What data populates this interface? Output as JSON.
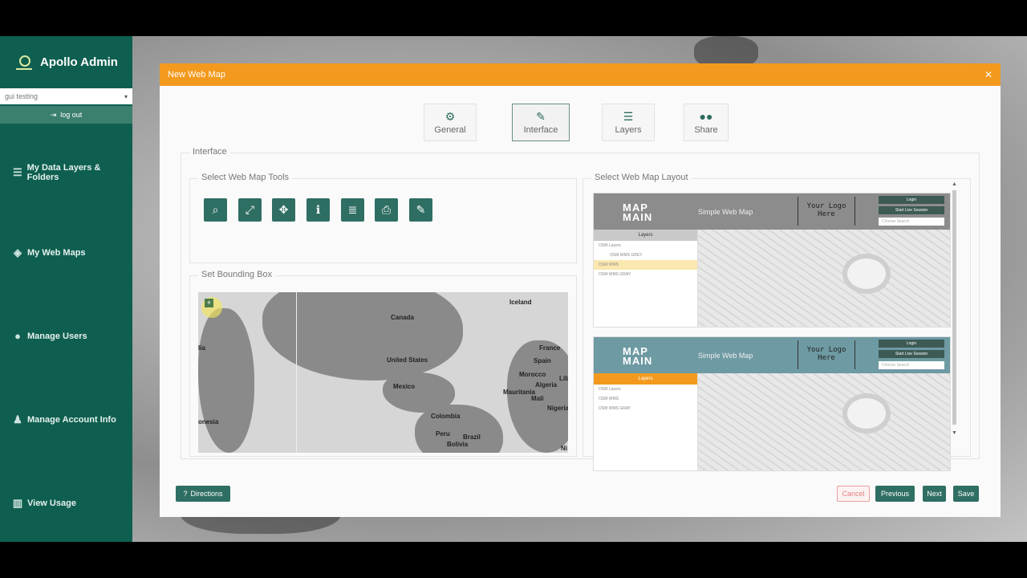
{
  "sidebar": {
    "brand": "Apollo Admin",
    "workspace": "gui testing",
    "logout_label": "log out",
    "items": [
      {
        "label": "My Data Layers & Folders",
        "icon": "list-icon"
      },
      {
        "label": "My Web Maps",
        "icon": "cube-icon"
      },
      {
        "label": "Manage Users",
        "icon": "users-icon"
      },
      {
        "label": "Manage Account Info",
        "icon": "person-icon"
      },
      {
        "label": "View Usage",
        "icon": "bar-chart-icon"
      }
    ]
  },
  "dialog": {
    "title": "New Web Map",
    "close_icon": "close-icon",
    "tabs": [
      {
        "label": "General",
        "icon": "gear-icon"
      },
      {
        "label": "Interface",
        "icon": "wrench-icon",
        "active": true
      },
      {
        "label": "Layers",
        "icon": "list-icon"
      },
      {
        "label": "Share",
        "icon": "users-icon"
      }
    ],
    "interface_legend": "Interface",
    "tools_legend": "Select Web Map Tools",
    "tools": [
      "search-icon",
      "expand-icon",
      "move-icon",
      "info-icon",
      "database-icon",
      "print-icon",
      "edit-icon"
    ],
    "bbox_legend": "Set Bounding Box",
    "bbox_labels": [
      "Iceland",
      "Canada",
      "lia",
      "United States",
      "France",
      "Spain",
      "Morocco",
      "Lib",
      "Mexico",
      "Algeria",
      "Mauritania",
      "Mali",
      "Nigeria",
      "Colombia",
      "Peru",
      "Brazil",
      "Bolivia",
      "onesia",
      "Ni"
    ],
    "layout_legend": "Select Web Map Layout",
    "layouts": [
      {
        "brand_line1": "MAP",
        "brand_line2": "MAIN",
        "title": "Simple Web Map",
        "logo_line1": "Your Logo",
        "logo_line2": "Here",
        "header_color": "#8c8c8c",
        "panel_title": "Layers",
        "panel_color": "#c9c9c9",
        "login": "Login",
        "live": "Start Live Session",
        "search": "Choose Search",
        "rows": [
          "OSM Layers",
          "OSM WMS GREY",
          "OSM WMS",
          "OSM WMS GRAY"
        ]
      },
      {
        "brand_line1": "MAP",
        "brand_line2": "MAIN",
        "title": "Simple Web Map",
        "logo_line1": "Your Logo",
        "logo_line2": "Here",
        "header_color": "#6e9aa3",
        "panel_title": "Layers",
        "panel_color": "#f39a1e",
        "login": "Login",
        "live": "Start Live Session",
        "search": "Choose Search",
        "rows": [
          "OSM Layers",
          "OSM WMS",
          "OSM WMS GRAY"
        ]
      }
    ],
    "footer": {
      "directions": "Directions",
      "cancel": "Cancel",
      "previous": "Previous",
      "next": "Next",
      "save": "Save"
    }
  },
  "colors": {
    "accent": "#f39a1e",
    "sidebar": "#0f5f50",
    "button": "#2f6e63",
    "cancel": "#e08080"
  }
}
